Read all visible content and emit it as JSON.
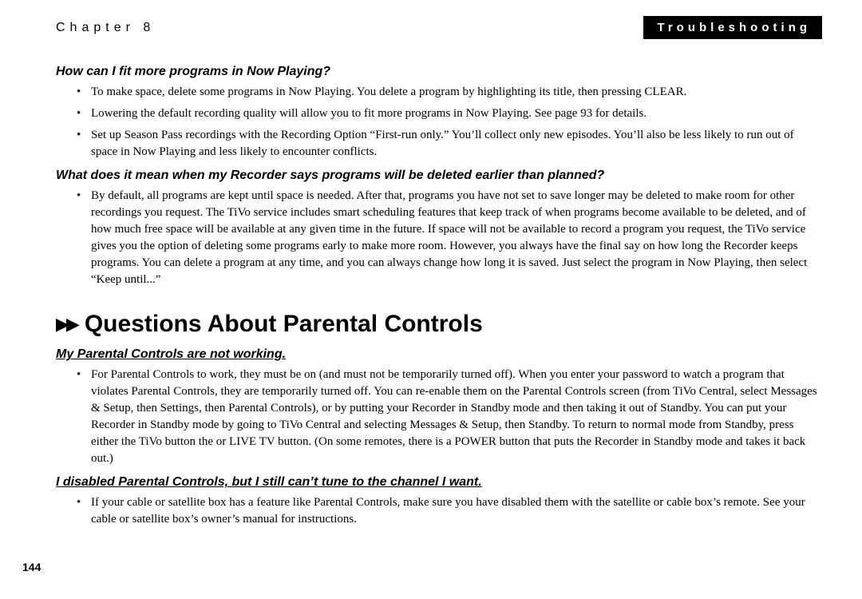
{
  "header": {
    "chapter": "Chapter 8",
    "section": "Troubleshooting"
  },
  "q1": {
    "title": "How can I fit more programs in Now Playing?",
    "bullets": [
      "To make space, delete some programs in Now Playing. You delete a program by highlighting its title, then pressing CLEAR.",
      "Lowering the default recording quality will allow you to fit more programs in Now Playing. See page 93 for details.",
      "Set up Season Pass recordings with the Recording Option “First-run only.” You’ll collect only new episodes. You’ll also be less likely to run out of space in Now Playing and less likely to encounter conflicts."
    ]
  },
  "q2": {
    "title": "What does it mean when my Recorder says programs will be deleted earlier than planned?",
    "bullets": [
      "By default, all programs are kept until space is needed. After that, programs you have not set to save longer may be deleted to make room for other recordings you request. The TiVo service includes smart scheduling features that keep track of when programs become available to be deleted, and of how much free space will be available at any given time in the future. If space will not be available to record a program you request, the TiVo service gives you the option of deleting some programs early to make more room. However, you always have the final say on how long the Recorder keeps programs. You can delete a program at any time, and you can always change how long it is saved. Just select the program in Now Playing, then select “Keep until...”"
    ]
  },
  "section_heading": "Questions About Parental Controls",
  "q3": {
    "title": "My Parental Controls are not working.",
    "bullets": [
      "For Parental Controls to work, they must be on (and must not be temporarily turned off). When you enter your password to watch a program that violates Parental Controls, they are temporarily turned off. You can re-enable them on the Parental Controls screen (from TiVo Central, select Messages & Setup, then Settings, then Parental Controls), or by putting your Recorder in Standby mode and then taking it out of Standby. You can put your Recorder in Standby mode by going to TiVo Central and selecting Messages & Setup, then Standby. To return to normal mode from Standby, press either the TiVo button the or LIVE TV button. (On some remotes, there is a POWER button that puts the Recorder in Standby mode and takes it back out.)"
    ]
  },
  "q4": {
    "title": "I disabled Parental Controls, but I still can’t tune to the channel I want.",
    "bullets": [
      "If your cable or satellite box has a feature like Parental Controls, make sure you have disabled them with the satellite or cable box’s remote. See your cable or satellite box’s owner’s manual for instructions."
    ]
  },
  "page_number": "144"
}
